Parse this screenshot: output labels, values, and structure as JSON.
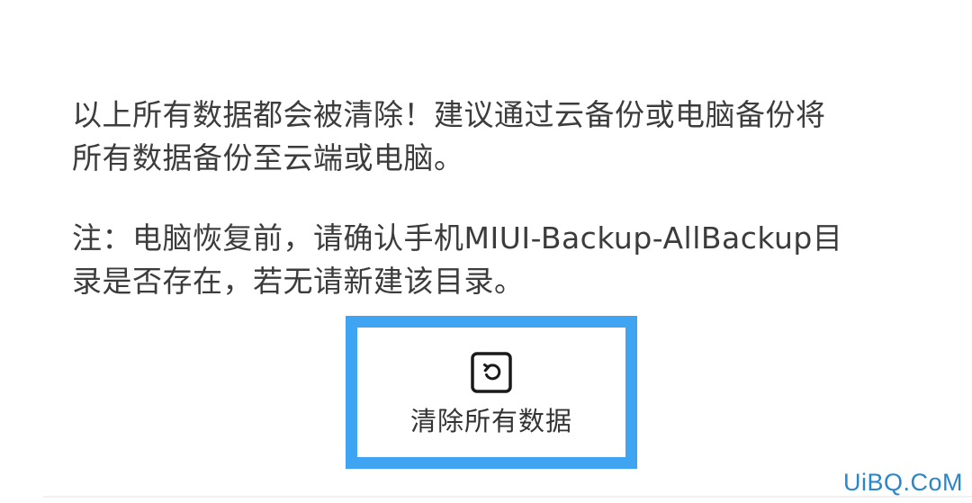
{
  "warning": {
    "line1": "以上所有数据都会被清除！建议通过云备份或电脑备份将",
    "line2": "所有数据备份至云端或电脑。"
  },
  "note": {
    "line1": "注：电脑恢复前，请确认手机MIUI-Backup-AllBackup目",
    "line2": "录是否存在，若无请新建该目录。"
  },
  "action": {
    "icon": "reset-icon",
    "label": "清除所有数据"
  },
  "watermark": "UiBQ.CoM",
  "colors": {
    "highlight_border": "#3fa4f2",
    "text": "#3c3c3c",
    "watermark": "#2a86c8"
  }
}
